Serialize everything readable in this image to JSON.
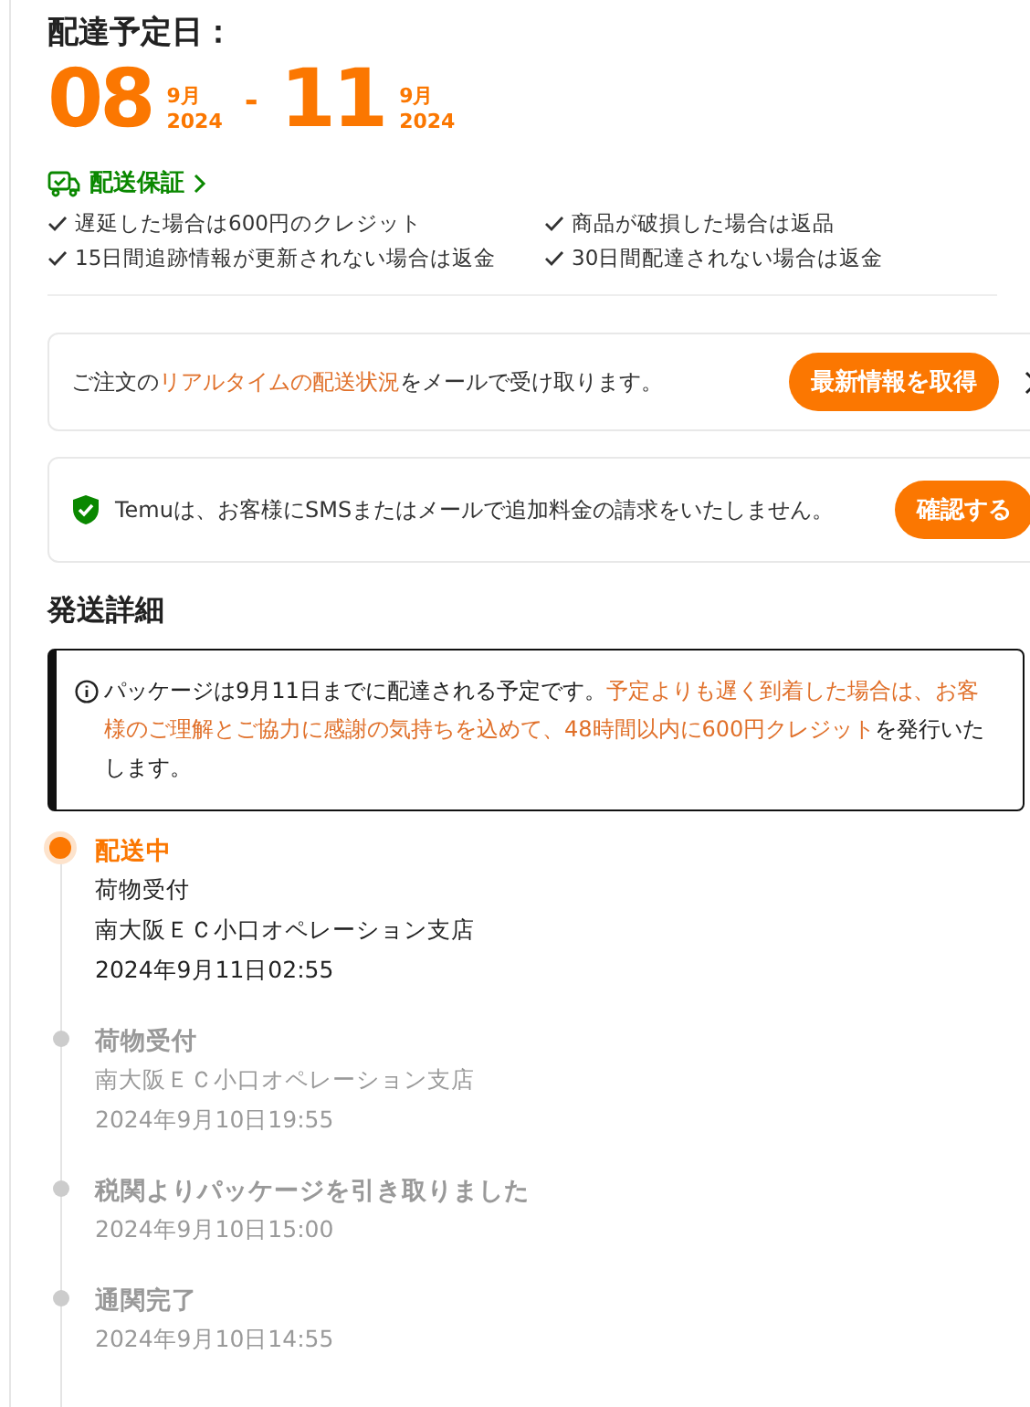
{
  "title": "配達予定日：",
  "dates": [
    {
      "day": "08",
      "month": "9月",
      "year": "2024"
    },
    {
      "day": "11",
      "month": "9月",
      "year": "2024"
    }
  ],
  "date_separator": "-",
  "guarantee": {
    "label": "配送保証",
    "items": [
      "遅延した場合は600円のクレジット",
      "商品が破損した場合は返品",
      "15日間追跡情報が更新されない場合は返金",
      "30日間配達されない場合は返金"
    ]
  },
  "email_card": {
    "segments": [
      {
        "text": "ご注文の",
        "highlight": false
      },
      {
        "text": "リアルタイムの配送状況",
        "highlight": true
      },
      {
        "text": "をメールで受け取ります。",
        "highlight": false
      }
    ],
    "button": "最新情報を取得"
  },
  "security_card": {
    "text": "Temuは、お客様にSMSまたはメールで追加料金の請求をいたしません。",
    "button": "確認する"
  },
  "section_title": "発送詳細",
  "notice": {
    "segments": [
      {
        "text": "パッケージは9月11日までに配達される予定です。",
        "highlight": false
      },
      {
        "text": "予定よりも遅く到着した場合は、お客様のご理解とご協力に感謝の気持ちを込めて、48時間以内に600円クレジット",
        "highlight": true
      },
      {
        "text": "を発行いたします。",
        "highlight": false
      }
    ]
  },
  "timeline": [
    {
      "title": "配送中",
      "current": true,
      "lines": [
        "荷物受付",
        "南大阪ＥＣ小口オペレーション支店",
        "2024年9月11日02:55"
      ]
    },
    {
      "title": "荷物受付",
      "current": false,
      "lines": [
        "南大阪ＥＣ小口オペレーション支店",
        "2024年9月10日19:55"
      ]
    },
    {
      "title": "税関よりパッケージを引き取りました",
      "current": false,
      "lines": [
        "2024年9月10日15:00"
      ]
    },
    {
      "title": "通関完了",
      "current": false,
      "lines": [
        "2024年9月10日14:55"
      ]
    }
  ]
}
